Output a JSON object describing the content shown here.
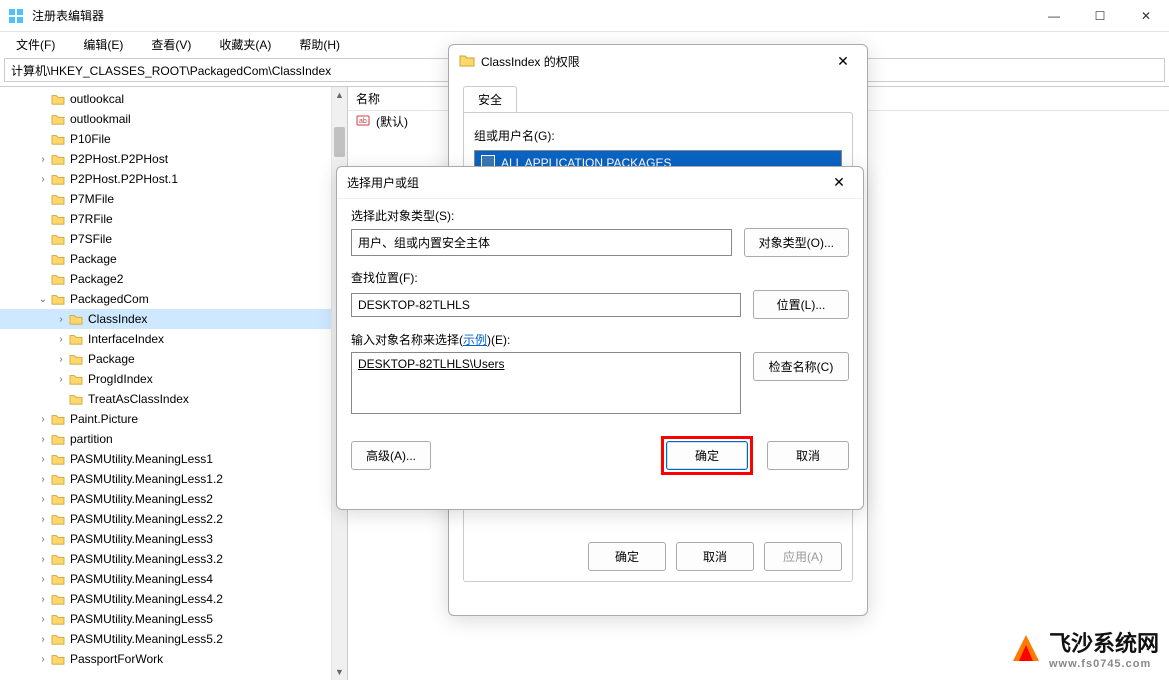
{
  "window": {
    "title": "注册表编辑器",
    "min": "—",
    "max": "☐",
    "close": "✕"
  },
  "menu": {
    "file": "文件(F)",
    "edit": "编辑(E)",
    "view": "查看(V)",
    "fav": "收藏夹(A)",
    "help": "帮助(H)"
  },
  "address": "计算机\\HKEY_CLASSES_ROOT\\PackagedCom\\ClassIndex",
  "tree": [
    {
      "d": 2,
      "e": "",
      "t": "outlookcal"
    },
    {
      "d": 2,
      "e": "",
      "t": "outlookmail"
    },
    {
      "d": 2,
      "e": "",
      "t": "P10File"
    },
    {
      "d": 2,
      "e": ">",
      "t": "P2PHost.P2PHost"
    },
    {
      "d": 2,
      "e": ">",
      "t": "P2PHost.P2PHost.1"
    },
    {
      "d": 2,
      "e": "",
      "t": "P7MFile"
    },
    {
      "d": 2,
      "e": "",
      "t": "P7RFile"
    },
    {
      "d": 2,
      "e": "",
      "t": "P7SFile"
    },
    {
      "d": 2,
      "e": "",
      "t": "Package"
    },
    {
      "d": 2,
      "e": "",
      "t": "Package2"
    },
    {
      "d": 2,
      "e": "v",
      "t": "PackagedCom"
    },
    {
      "d": 3,
      "e": ">",
      "t": "ClassIndex",
      "sel": true
    },
    {
      "d": 3,
      "e": ">",
      "t": "InterfaceIndex"
    },
    {
      "d": 3,
      "e": ">",
      "t": "Package"
    },
    {
      "d": 3,
      "e": ">",
      "t": "ProgIdIndex"
    },
    {
      "d": 3,
      "e": "",
      "t": "TreatAsClassIndex"
    },
    {
      "d": 2,
      "e": ">",
      "t": "Paint.Picture"
    },
    {
      "d": 2,
      "e": ">",
      "t": "partition"
    },
    {
      "d": 2,
      "e": ">",
      "t": "PASMUtility.MeaningLess1"
    },
    {
      "d": 2,
      "e": ">",
      "t": "PASMUtility.MeaningLess1.2"
    },
    {
      "d": 2,
      "e": ">",
      "t": "PASMUtility.MeaningLess2"
    },
    {
      "d": 2,
      "e": ">",
      "t": "PASMUtility.MeaningLess2.2"
    },
    {
      "d": 2,
      "e": ">",
      "t": "PASMUtility.MeaningLess3"
    },
    {
      "d": 2,
      "e": ">",
      "t": "PASMUtility.MeaningLess3.2"
    },
    {
      "d": 2,
      "e": ">",
      "t": "PASMUtility.MeaningLess4"
    },
    {
      "d": 2,
      "e": ">",
      "t": "PASMUtility.MeaningLess4.2"
    },
    {
      "d": 2,
      "e": ">",
      "t": "PASMUtility.MeaningLess5"
    },
    {
      "d": 2,
      "e": ">",
      "t": "PASMUtility.MeaningLess5.2"
    },
    {
      "d": 2,
      "e": ">",
      "t": "PassportForWork"
    }
  ],
  "list": {
    "hdr": "名称",
    "defname": "(默认)"
  },
  "perm": {
    "title": "ClassIndex 的权限",
    "tab": "安全",
    "groups_label": "组或用户名(G):",
    "pkg": "ALL APPLICATION PACKAGES",
    "ok": "确定",
    "cancel": "取消",
    "apply": "应用(A)"
  },
  "sel": {
    "title": "选择用户或组",
    "obj_label": "选择此对象类型(S):",
    "obj_value": "用户、组或内置安全主体",
    "obj_btn": "对象类型(O)...",
    "loc_label": "查找位置(F):",
    "loc_value": "DESKTOP-82TLHLS",
    "loc_btn": "位置(L)...",
    "name_label_a": "输入对象名称来选择(",
    "name_label_link": "示例",
    "name_label_b": ")(E):",
    "name_value": "DESKTOP-82TLHLS\\Users",
    "check_btn": "检查名称(C)",
    "adv": "高级(A)...",
    "ok": "确定",
    "cancel": "取消"
  },
  "watermark": {
    "big": "飞沙系统网",
    "small": "www.fs0745.com"
  }
}
